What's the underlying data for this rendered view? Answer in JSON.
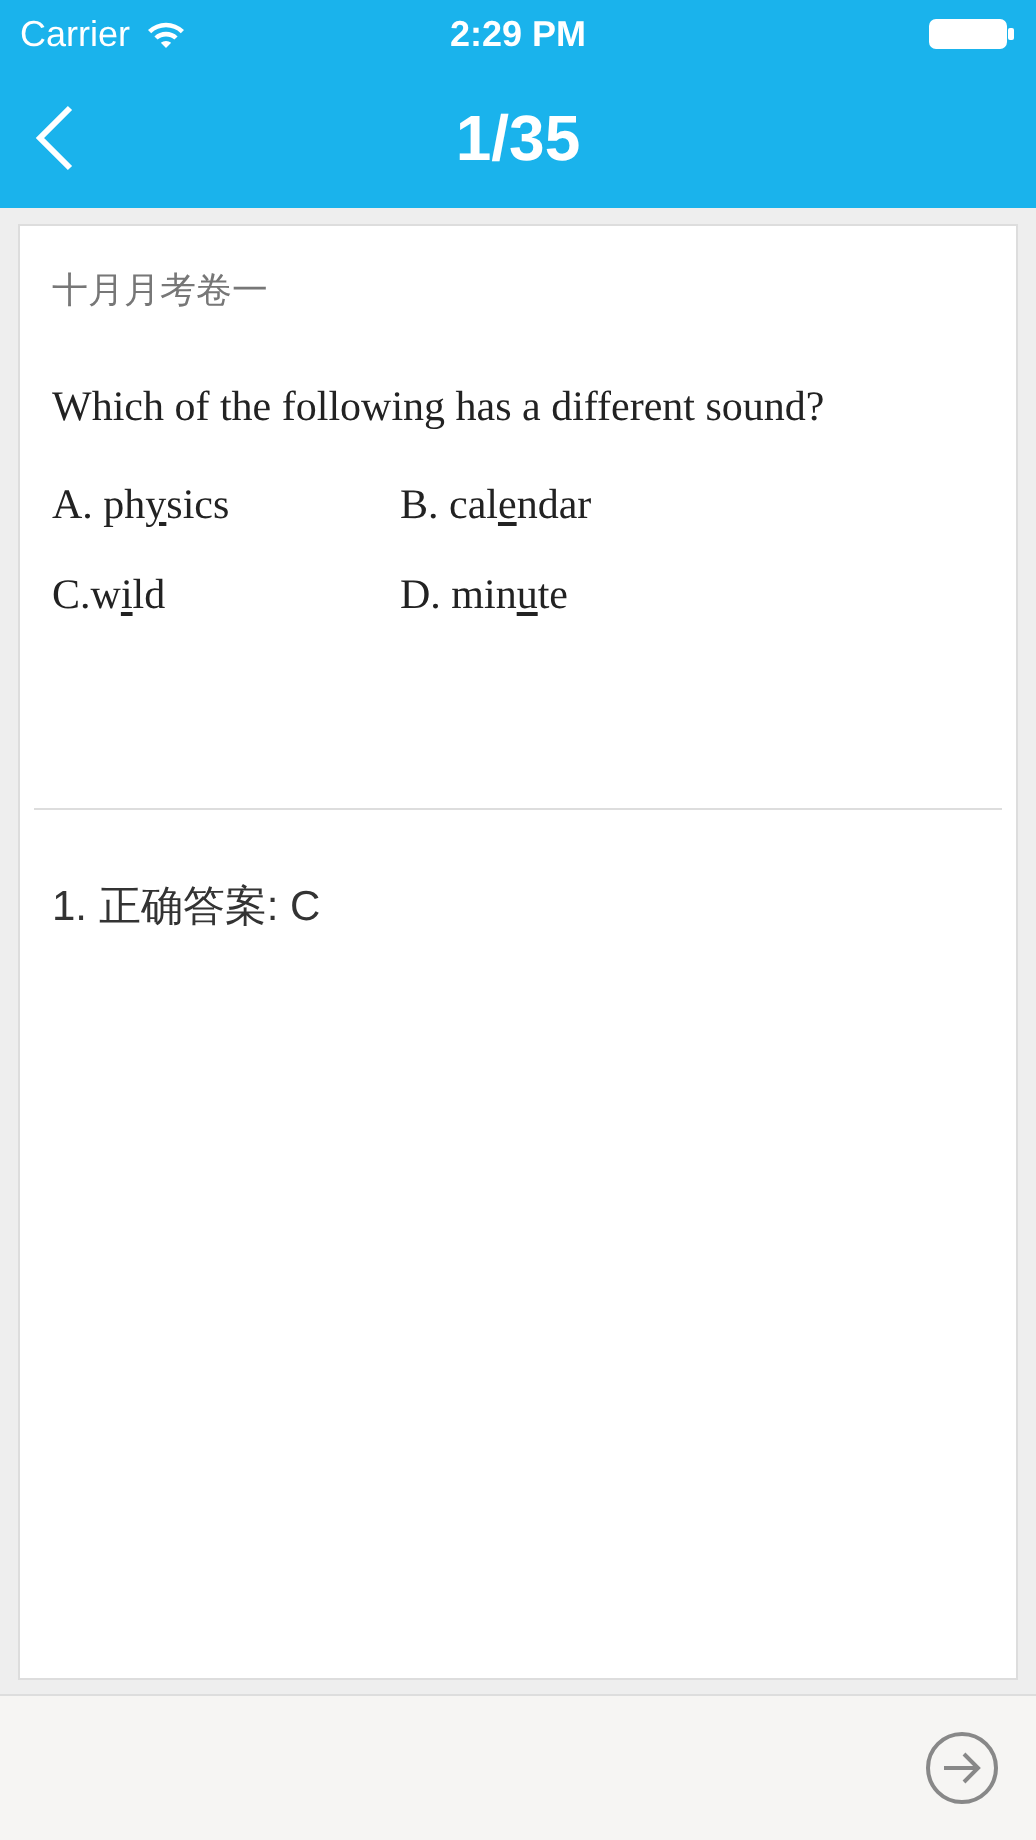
{
  "status_bar": {
    "carrier": "Carrier",
    "time": "2:29 PM"
  },
  "nav": {
    "title": "1/35"
  },
  "question": {
    "paper": "十月月考卷一",
    "text": "Which of the following has a different sound?",
    "options": [
      {
        "before": "A. ph",
        "underlined": "y",
        "after": "sics"
      },
      {
        "before": "B. cal",
        "underlined": "e",
        "after": "ndar"
      },
      {
        "before": "C.w",
        "underlined": "i",
        "after": "ld"
      },
      {
        "before": "D. min",
        "underlined": "u",
        "after": "te"
      }
    ]
  },
  "answer": "1. 正确答案: C"
}
